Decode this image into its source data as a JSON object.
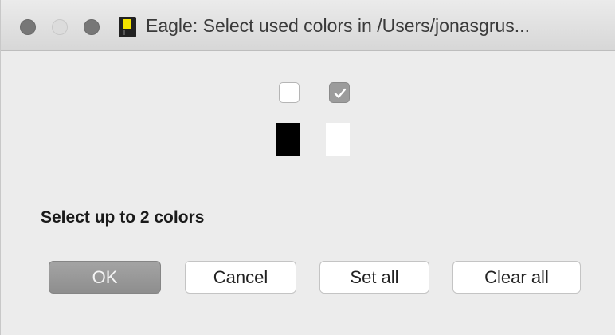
{
  "window": {
    "title": "Eagle: Select used colors in /Users/jonasgrus..."
  },
  "app_icon": {
    "name": "eagle-app-icon",
    "colors": {
      "body": "#222222",
      "accent": "#f5e400"
    }
  },
  "colors": [
    {
      "hex": "#000000",
      "checked": false
    },
    {
      "hex": "#ffffff",
      "checked": true
    }
  ],
  "prompt": "Select up to 2 colors",
  "buttons": {
    "ok": "OK",
    "cancel": "Cancel",
    "set_all": "Set all",
    "clear_all": "Clear all"
  }
}
